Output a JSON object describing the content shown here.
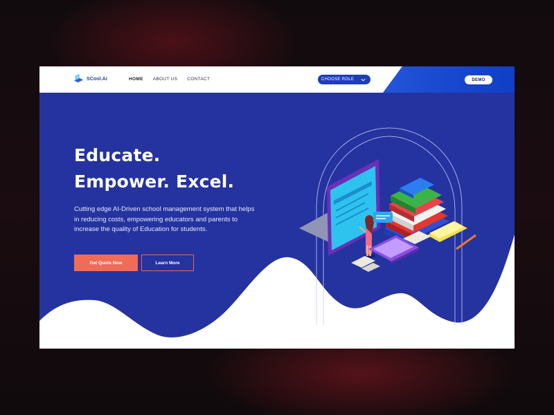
{
  "nav": {
    "brand": "SCool.Ai",
    "links": [
      {
        "label": "HOME",
        "active": true
      },
      {
        "label": "ABOUT US",
        "active": false
      },
      {
        "label": "CONTACT",
        "active": false
      }
    ],
    "role_select": "CHOOSE ROLE",
    "demo": "DEMO"
  },
  "hero": {
    "headline_line1": "Educate.",
    "headline_line2": "Empower. Excel.",
    "description": "Cutting edge AI-Driven school management system that helps in reducing costs, empowering educators and parents to increase the quality of Education for students.",
    "cta_primary": "Get Quote Now",
    "cta_secondary": "Learn More"
  },
  "colors": {
    "hero_bg": "#2533a0",
    "accent_blue": "#1d3dbd",
    "cta_orange": "#f26b55",
    "page_bg": "#0f0a0c"
  },
  "icons": [
    "laptop-logo-icon",
    "chevron-down-icon"
  ]
}
